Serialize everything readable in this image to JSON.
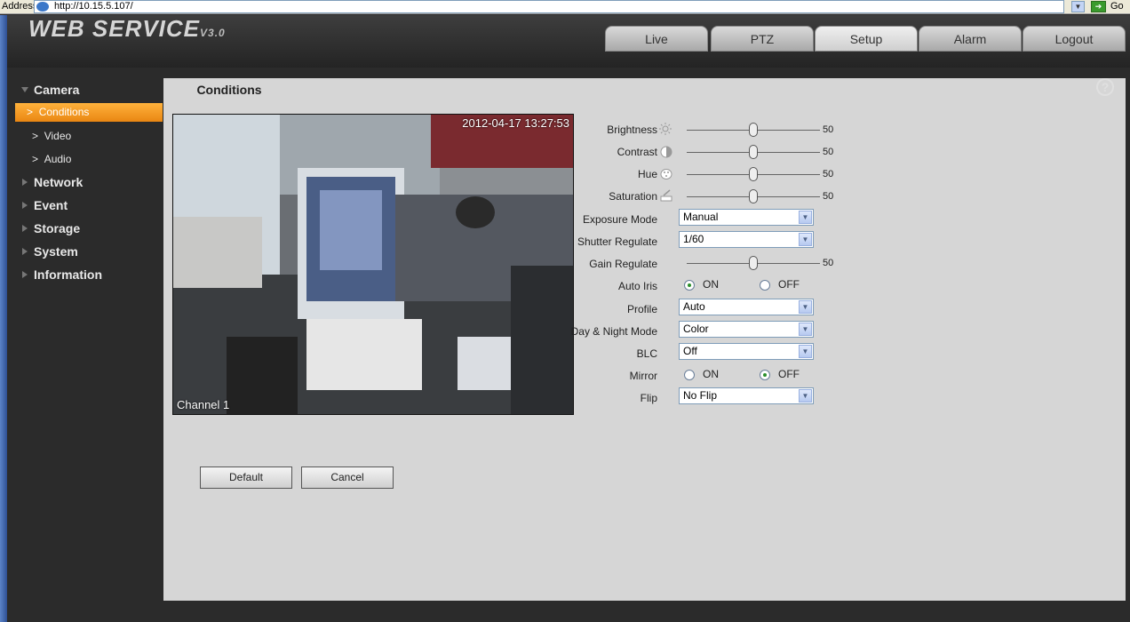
{
  "browser": {
    "address_label": "Address",
    "url": "http://10.15.5.107/",
    "go_label": "Go"
  },
  "app": {
    "logo": "WEB  SERVICE",
    "version": "V3.0"
  },
  "nav_tabs": [
    "Live",
    "PTZ",
    "Setup",
    "Alarm",
    "Logout"
  ],
  "active_tab": "Setup",
  "sidebar": {
    "groups": [
      {
        "label": "Camera",
        "expanded": true,
        "items": [
          "Conditions",
          "Video",
          "Audio"
        ]
      },
      {
        "label": "Network"
      },
      {
        "label": "Event"
      },
      {
        "label": "Storage"
      },
      {
        "label": "System"
      },
      {
        "label": "Information"
      }
    ],
    "active_item": "Conditions",
    "sub_prefix": ">"
  },
  "panel": {
    "tab": "Conditions",
    "help": "?"
  },
  "video": {
    "timestamp": "2012-04-17 13:27:53",
    "channel": "Channel 1"
  },
  "settings": {
    "brightness": {
      "label": "Brightness",
      "value": "50"
    },
    "contrast": {
      "label": "Contrast",
      "value": "50"
    },
    "hue": {
      "label": "Hue",
      "value": "50"
    },
    "saturation": {
      "label": "Saturation",
      "value": "50"
    },
    "exposure_mode": {
      "label": "Exposure Mode",
      "value": "Manual"
    },
    "shutter": {
      "label": "Shutter Regulate",
      "value": "1/60"
    },
    "gain": {
      "label": "Gain Regulate",
      "value": "50"
    },
    "auto_iris": {
      "label": "Auto Iris",
      "on": "ON",
      "off": "OFF",
      "selected": "ON"
    },
    "profile": {
      "label": "Profile",
      "value": "Auto"
    },
    "day_night": {
      "label": "Day & Night Mode",
      "value": "Color"
    },
    "blc": {
      "label": "BLC",
      "value": "Off"
    },
    "mirror": {
      "label": "Mirror",
      "on": "ON",
      "off": "OFF",
      "selected": "OFF"
    },
    "flip": {
      "label": "Flip",
      "value": "No Flip"
    }
  },
  "buttons": {
    "default": "Default",
    "cancel": "Cancel"
  },
  "colors": {
    "accent": "#f39c1f",
    "background": "#2b2b2b",
    "panel": "#d6d6d6"
  }
}
